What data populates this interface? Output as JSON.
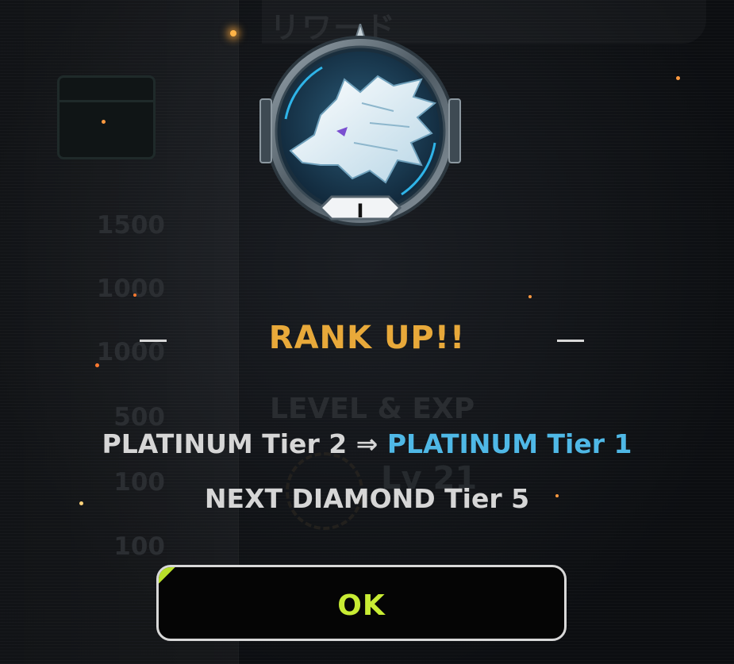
{
  "background": {
    "reward_title": "リワード",
    "numbers": [
      "1500",
      "1000",
      "1000",
      "500",
      "100",
      "100"
    ],
    "level_title": "LEVEL & EXP",
    "level_value": "Lv 21"
  },
  "emblem": {
    "icon": "wolf-icon",
    "tier_roman": "I"
  },
  "dialog": {
    "title": "RANK UP!!",
    "from_rank": "PLATINUM Tier 2",
    "arrow": "⇒",
    "to_rank": "PLATINUM Tier 1",
    "next_rank": "NEXT DIAMOND Tier 5",
    "ok_label": "OK"
  },
  "colors": {
    "title": "#e8a93a",
    "to_rank": "#4fb8e6",
    "ok_text": "#c8ec34"
  }
}
